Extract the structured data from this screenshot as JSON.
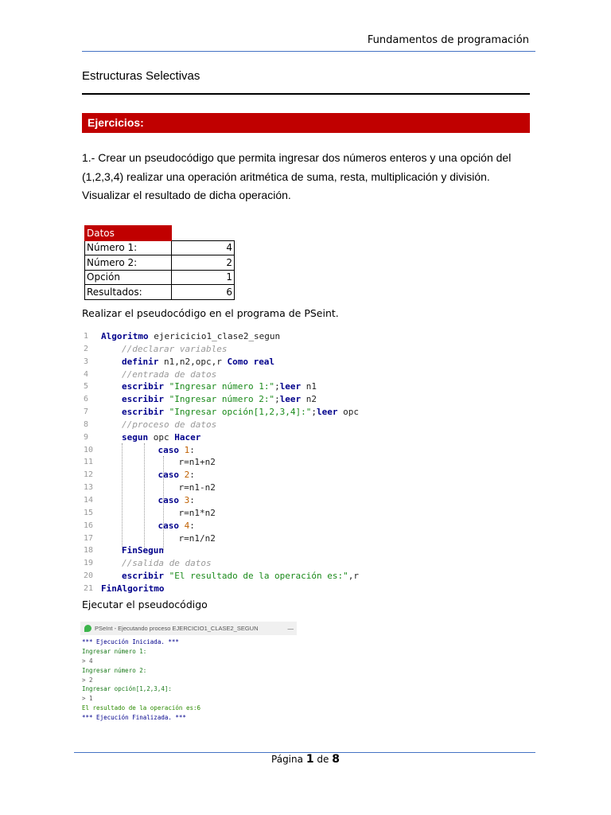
{
  "header": {
    "running_title": "Fundamentos de programación"
  },
  "section_title": "Estructuras Selectivas",
  "band_label": "Ejercicios:",
  "exercise_text": "1.- Crear un pseudocódigo que permita ingresar dos números enteros y una opción del (1,2,3,4) realizar una operación aritmética de suma, resta, multiplicación y división. Visualizar el resultado de dicha operación.",
  "table": {
    "header": "Datos",
    "rows": [
      {
        "label": "Número 1:",
        "value": "4"
      },
      {
        "label": "Número 2:",
        "value": "2"
      },
      {
        "label": "Opción",
        "value": "1"
      },
      {
        "label": "Resultados:",
        "value": "6"
      }
    ]
  },
  "instruction1": "Realizar el pseudocódigo en el programa de PSeint.",
  "code": [
    {
      "n": "1",
      "indent": 0,
      "tokens": [
        [
          "kw",
          "Algoritmo"
        ],
        [
          "id",
          " ejericicio1_clase2_segun"
        ]
      ]
    },
    {
      "n": "2",
      "indent": 1,
      "tokens": [
        [
          "cm",
          "//declarar variables"
        ]
      ]
    },
    {
      "n": "3",
      "indent": 1,
      "tokens": [
        [
          "kw",
          "definir"
        ],
        [
          "id",
          " n1,n2,opc,r "
        ],
        [
          "kw",
          "Como real"
        ]
      ]
    },
    {
      "n": "4",
      "indent": 1,
      "tokens": [
        [
          "cm",
          "//entrada de datos"
        ]
      ]
    },
    {
      "n": "5",
      "indent": 1,
      "tokens": [
        [
          "kw",
          "escribir"
        ],
        [
          "st",
          " \"Ingresar número 1:\""
        ],
        [
          "id",
          ";"
        ],
        [
          "kw",
          "leer"
        ],
        [
          "id",
          " n1"
        ]
      ]
    },
    {
      "n": "6",
      "indent": 1,
      "tokens": [
        [
          "kw",
          "escribir"
        ],
        [
          "st",
          " \"Ingresar número 2:\""
        ],
        [
          "id",
          ";"
        ],
        [
          "kw",
          "leer"
        ],
        [
          "id",
          " n2"
        ]
      ]
    },
    {
      "n": "7",
      "indent": 1,
      "tokens": [
        [
          "kw",
          "escribir"
        ],
        [
          "st",
          " \"Ingresar opción[1,2,3,4]:\""
        ],
        [
          "id",
          ";"
        ],
        [
          "kw",
          "leer"
        ],
        [
          "id",
          " opc"
        ]
      ]
    },
    {
      "n": "8",
      "indent": 1,
      "tokens": [
        [
          "cm",
          "//proceso de datos"
        ]
      ]
    },
    {
      "n": "9",
      "indent": 1,
      "tokens": [
        [
          "kw",
          "segun"
        ],
        [
          "id",
          " opc "
        ],
        [
          "kw",
          "Hacer"
        ]
      ]
    },
    {
      "n": "10",
      "indent": 2.75,
      "tokens": [
        [
          "kw",
          "caso"
        ],
        [
          "nu",
          " 1"
        ],
        [
          "id",
          ":"
        ]
      ]
    },
    {
      "n": "11",
      "indent": 3.75,
      "tokens": [
        [
          "id",
          "r=n1+n2"
        ]
      ]
    },
    {
      "n": "12",
      "indent": 2.75,
      "tokens": [
        [
          "kw",
          "caso"
        ],
        [
          "nu",
          " 2"
        ],
        [
          "id",
          ":"
        ]
      ]
    },
    {
      "n": "13",
      "indent": 3.75,
      "tokens": [
        [
          "id",
          "r=n1-n2"
        ]
      ]
    },
    {
      "n": "14",
      "indent": 2.75,
      "tokens": [
        [
          "kw",
          "caso"
        ],
        [
          "nu",
          " 3"
        ],
        [
          "id",
          ":"
        ]
      ]
    },
    {
      "n": "15",
      "indent": 3.75,
      "tokens": [
        [
          "id",
          "r=n1*n2"
        ]
      ]
    },
    {
      "n": "16",
      "indent": 2.75,
      "tokens": [
        [
          "kw",
          "caso"
        ],
        [
          "nu",
          " 4"
        ],
        [
          "id",
          ":"
        ]
      ]
    },
    {
      "n": "17",
      "indent": 3.75,
      "tokens": [
        [
          "id",
          "r=n1/n2"
        ]
      ]
    },
    {
      "n": "18",
      "indent": 1,
      "tokens": [
        [
          "kw",
          "FinSegun"
        ]
      ]
    },
    {
      "n": "19",
      "indent": 1,
      "tokens": [
        [
          "cm",
          "//salida de datos"
        ]
      ]
    },
    {
      "n": "20",
      "indent": 1,
      "tokens": [
        [
          "kw",
          "escribir"
        ],
        [
          "st",
          " \"El resultado de la operación es:\""
        ],
        [
          "id",
          ",r"
        ]
      ]
    },
    {
      "n": "21",
      "indent": 0,
      "tokens": [
        [
          "kw",
          "FinAlgoritmo"
        ]
      ]
    }
  ],
  "instruction2": "Ejecutar el pseudocódigo",
  "console": {
    "title": "PSeInt - Ejecutando proceso EJERCICIO1_CLASE2_SEGUN",
    "minimize": "—",
    "lines": [
      {
        "t": "sys",
        "text": "*** Ejecución Iniciada. ***"
      },
      {
        "t": "out",
        "text": "Ingresar número 1:"
      },
      {
        "t": "inp",
        "text": "> 4"
      },
      {
        "t": "out",
        "text": "Ingresar número 2:"
      },
      {
        "t": "inp",
        "text": "> 2"
      },
      {
        "t": "out",
        "text": "Ingresar opción[1,2,3,4]:"
      },
      {
        "t": "inp",
        "text": "> 1"
      },
      {
        "t": "res",
        "text": "El resultado de la operación es:6"
      },
      {
        "t": "sys",
        "text": "*** Ejecución Finalizada. ***"
      }
    ]
  },
  "footer": {
    "page_word": "Página",
    "current": "1",
    "of_word": "de",
    "total": "8"
  }
}
